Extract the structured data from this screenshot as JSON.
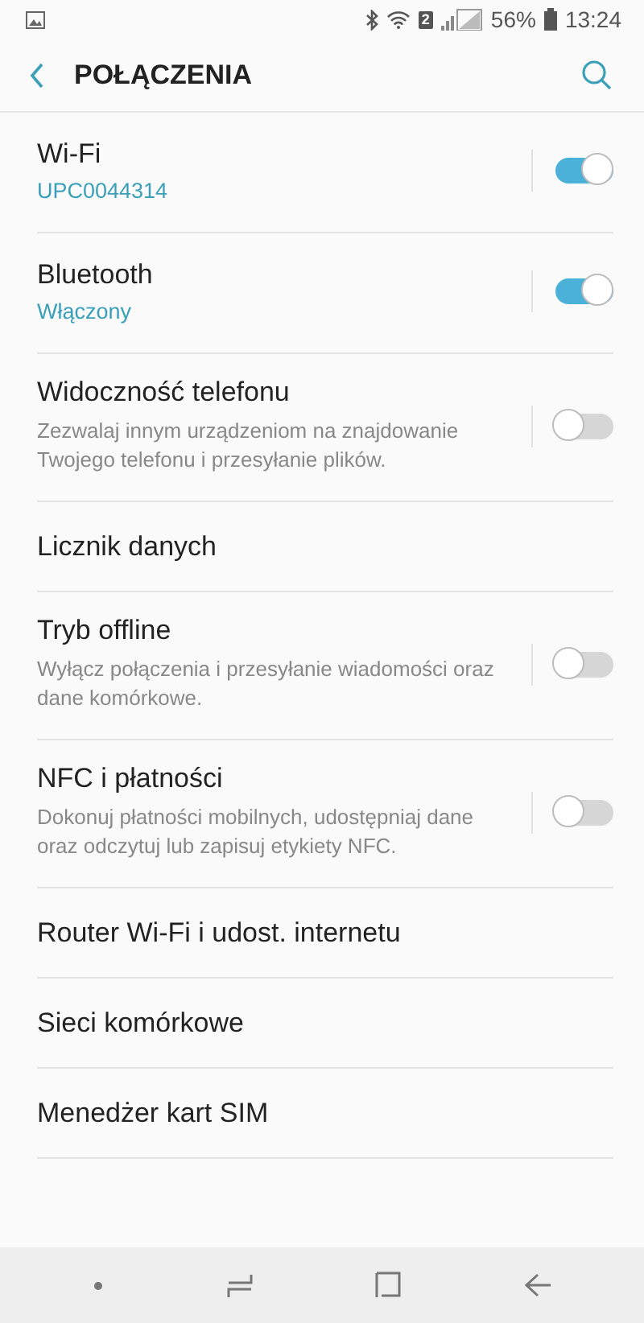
{
  "status_bar": {
    "sim": "2",
    "battery": "56%",
    "time": "13:24"
  },
  "header": {
    "title": "POŁĄCZENIA"
  },
  "items": [
    {
      "kind": "toggle",
      "title": "Wi-Fi",
      "status": "UPC0044314",
      "on": true
    },
    {
      "kind": "toggle",
      "title": "Bluetooth",
      "status": "Włączony",
      "on": true
    },
    {
      "kind": "toggle",
      "title": "Widoczność telefonu",
      "description": "Zezwalaj innym urządzeniom na znajdowanie Twojego telefonu i przesyłanie plików.",
      "on": false
    },
    {
      "kind": "link",
      "title": "Licznik danych"
    },
    {
      "kind": "toggle",
      "title": "Tryb offline",
      "description": "Wyłącz połączenia i przesyłanie wiadomości oraz dane komórkowe.",
      "on": false
    },
    {
      "kind": "toggle",
      "title": "NFC i płatności",
      "description": "Dokonuj płatności mobilnych, udostępniaj dane oraz odczytuj lub zapisuj etykiety NFC.",
      "on": false
    },
    {
      "kind": "link",
      "title": "Router Wi-Fi i udost. internetu"
    },
    {
      "kind": "link",
      "title": "Sieci komórkowe"
    },
    {
      "kind": "link",
      "title": "Menedżer kart SIM"
    }
  ]
}
